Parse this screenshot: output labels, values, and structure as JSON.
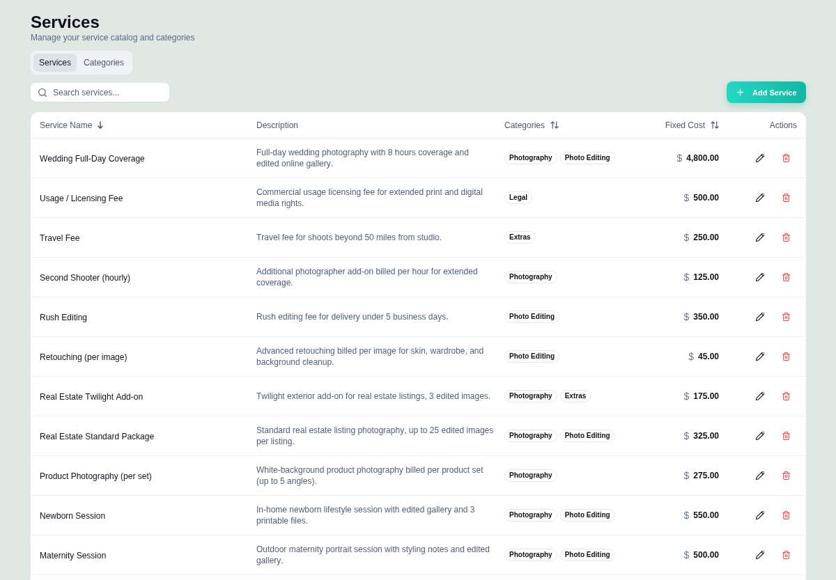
{
  "page": {
    "title": "Services",
    "subtitle": "Manage your service catalog and categories"
  },
  "tabs": [
    {
      "label": "Services",
      "selected": true
    },
    {
      "label": "Categories",
      "selected": false
    }
  ],
  "search": {
    "placeholder": "Search services..."
  },
  "add_button": {
    "label": "Add Service"
  },
  "table": {
    "columns": [
      {
        "label": "Service Name",
        "kind": "name",
        "sortable": true,
        "sorted": true
      },
      {
        "label": "Description",
        "kind": "description",
        "sortable": false,
        "sorted": false
      },
      {
        "label": "Categories",
        "kind": "tags",
        "sortable": true,
        "sorted": false
      },
      {
        "label": "Fixed Cost",
        "kind": "money",
        "sortable": true,
        "sorted": false
      },
      {
        "label": "Actions",
        "kind": "actions",
        "sortable": false,
        "sorted": false
      }
    ],
    "rows": [
      {
        "name": "Wedding Full-Day Coverage",
        "description": "Full-day wedding photography with 8 hours coverage and edited online gallery.",
        "categories": [
          "Photography",
          "Photo Editing"
        ],
        "currency": "$",
        "cost": "4,800.00"
      },
      {
        "name": "Usage / Licensing Fee",
        "description": "Commercial usage licensing fee for extended print and digital media rights.",
        "categories": [
          "Legal"
        ],
        "currency": "$",
        "cost": "500.00"
      },
      {
        "name": "Travel Fee",
        "description": "Travel fee for shoots beyond 50 miles from studio.",
        "categories": [
          "Extras"
        ],
        "currency": "$",
        "cost": "250.00"
      },
      {
        "name": "Second Shooter (hourly)",
        "description": "Additional photographer add-on billed per hour for extended coverage.",
        "categories": [
          "Photography"
        ],
        "currency": "$",
        "cost": "125.00"
      },
      {
        "name": "Rush Editing",
        "description": "Rush editing fee for delivery under 5 business days.",
        "categories": [
          "Photo Editing"
        ],
        "currency": "$",
        "cost": "350.00"
      },
      {
        "name": "Retouching (per image)",
        "description": "Advanced retouching billed per image for skin, wardrobe, and background cleanup.",
        "categories": [
          "Photo Editing"
        ],
        "currency": "$",
        "cost": "45.00"
      },
      {
        "name": "Real Estate Twilight Add-on",
        "description": "Twilight exterior add-on for real estate listings, 3 edited images.",
        "categories": [
          "Photography",
          "Extras"
        ],
        "currency": "$",
        "cost": "175.00"
      },
      {
        "name": "Real Estate Standard Package",
        "description": "Standard real estate listing photography, up to 25 edited images per listing.",
        "categories": [
          "Photography",
          "Photo Editing"
        ],
        "currency": "$",
        "cost": "325.00"
      },
      {
        "name": "Product Photography (per set)",
        "description": "White-background product photography billed per product set (up to 5 angles).",
        "categories": [
          "Photography"
        ],
        "currency": "$",
        "cost": "275.00"
      },
      {
        "name": "Newborn Session",
        "description": "In-home newborn lifestyle session with edited gallery and 3 printable files.",
        "categories": [
          "Photography",
          "Photo Editing"
        ],
        "currency": "$",
        "cost": "550.00"
      },
      {
        "name": "Maternity Session",
        "description": "Outdoor maternity portrait session with styling notes and edited gallery.",
        "categories": [
          "Photography",
          "Photo Editing"
        ],
        "currency": "$",
        "cost": "500.00"
      }
    ]
  }
}
